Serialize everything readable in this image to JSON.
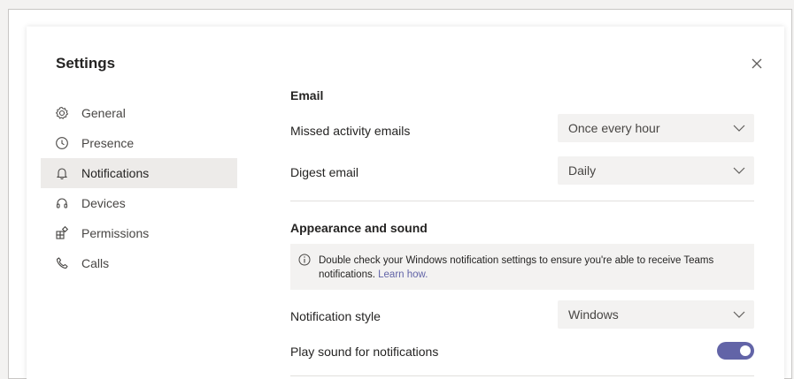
{
  "dialog": {
    "title": "Settings"
  },
  "nav": {
    "items": [
      {
        "label": "General",
        "icon": "gear-icon",
        "active": false
      },
      {
        "label": "Presence",
        "icon": "clock-icon",
        "active": false
      },
      {
        "label": "Notifications",
        "icon": "bell-icon",
        "active": true
      },
      {
        "label": "Devices",
        "icon": "headset-icon",
        "active": false
      },
      {
        "label": "Permissions",
        "icon": "apps-icon",
        "active": false
      },
      {
        "label": "Calls",
        "icon": "phone-icon",
        "active": false
      }
    ]
  },
  "email": {
    "heading": "Email",
    "missed_label": "Missed activity emails",
    "missed_value": "Once every hour",
    "digest_label": "Digest email",
    "digest_value": "Daily"
  },
  "appearance": {
    "heading": "Appearance and sound",
    "info_text": "Double check your Windows notification settings to ensure you're able to receive Teams notifications.",
    "info_link": "Learn how.",
    "style_label": "Notification style",
    "style_value": "Windows",
    "sound_label": "Play sound for notifications",
    "sound_enabled": true
  },
  "colors": {
    "accent": "#6264a7",
    "active_nav_bg": "#edebe9",
    "select_bg": "#f3f2f1"
  }
}
